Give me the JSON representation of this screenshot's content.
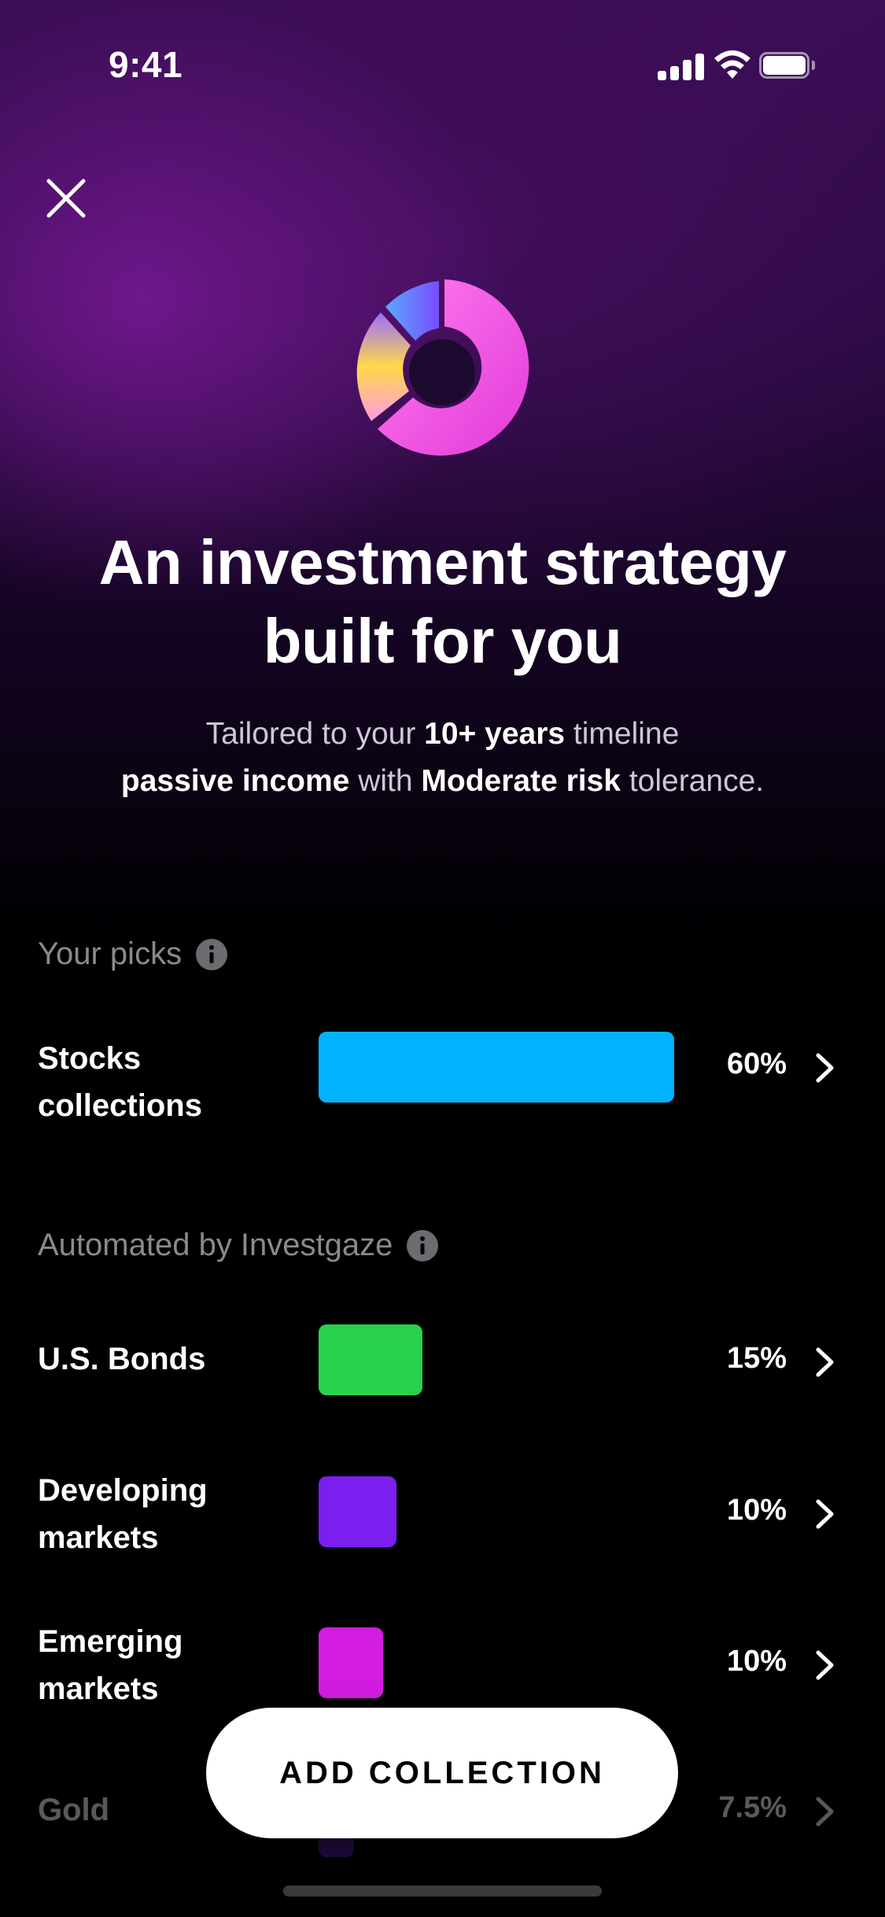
{
  "status_bar": {
    "time": "9:41"
  },
  "hero": {
    "headline_line1": "An investment strategy",
    "headline_line2": "built for you",
    "sub_prefix": "Tailored to your ",
    "sub_timeline": "10+ years",
    "sub_mid": " timeline",
    "sub_goal": "passive income",
    "sub_with": " with ",
    "sub_risk": "Moderate risk",
    "sub_suffix": " tolerance."
  },
  "picks": {
    "label": "Your picks",
    "items": [
      {
        "name_line1": "Stocks",
        "name_line2": "collections",
        "percent": "60%",
        "share": 60,
        "color": "#00b2ff"
      }
    ]
  },
  "automated": {
    "label": "Automated by Investgaze",
    "items": [
      {
        "name_line1": "U.S. Bonds",
        "name_line2": "",
        "percent": "15%",
        "share": 15,
        "color": "#29d14f"
      },
      {
        "name_line1": "Developing",
        "name_line2": "markets",
        "percent": "10%",
        "share": 10,
        "color": "#7a1ff0"
      },
      {
        "name_line1": "Emerging",
        "name_line2": "markets",
        "percent": "10%",
        "share": 10,
        "color": "#d21ce0"
      },
      {
        "name_line1": "Gold",
        "name_line2": "",
        "percent": "7.5%",
        "share": 7.5,
        "color": "#5a1aa8"
      }
    ]
  },
  "cta": {
    "label": "ADD COLLECTION"
  },
  "icons": {
    "close": "close-icon",
    "info": "info-icon",
    "chevron": "chevron-right-icon"
  }
}
